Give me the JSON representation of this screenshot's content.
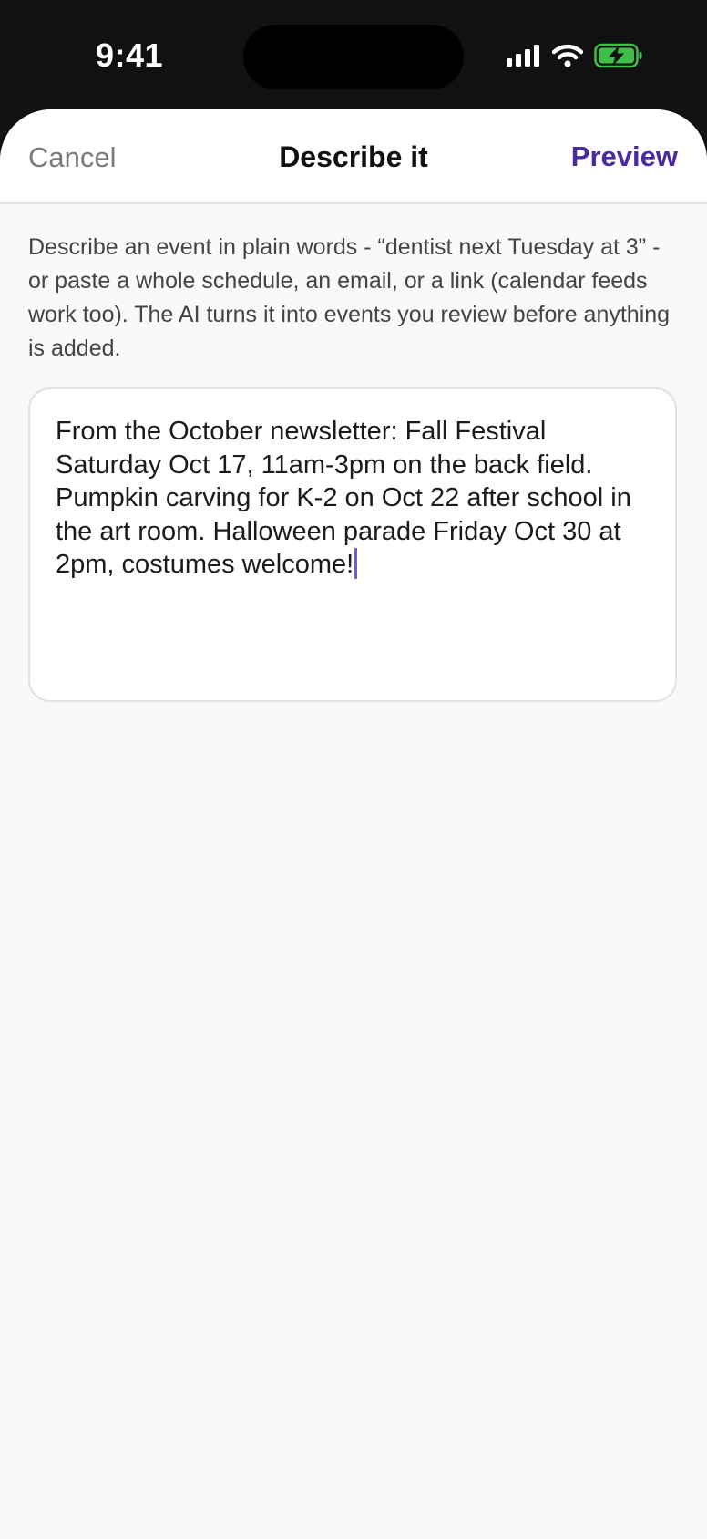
{
  "status_bar": {
    "time": "9:41",
    "icons": [
      "cellular-signal-icon",
      "wifi-icon",
      "battery-charging-icon"
    ],
    "battery_color": "#3fbf4a"
  },
  "nav": {
    "cancel_label": "Cancel",
    "title": "Describe it",
    "preview_label": "Preview",
    "accent_color": "#4b2a9e"
  },
  "helper_text": "Describe an event in plain words - “dentist next Tuesday at 3” - or paste a whole schedule, an email, or a link (calendar feeds work too). The AI turns it into events you review before anything is added.",
  "input": {
    "value": "From the October newsletter: Fall Festival Saturday Oct 17, 11am-3pm on the back field. Pumpkin carving for K-2 on Oct 22 after school in the art room. Halloween parade Friday Oct 30 at 2pm, costumes welcome!"
  }
}
